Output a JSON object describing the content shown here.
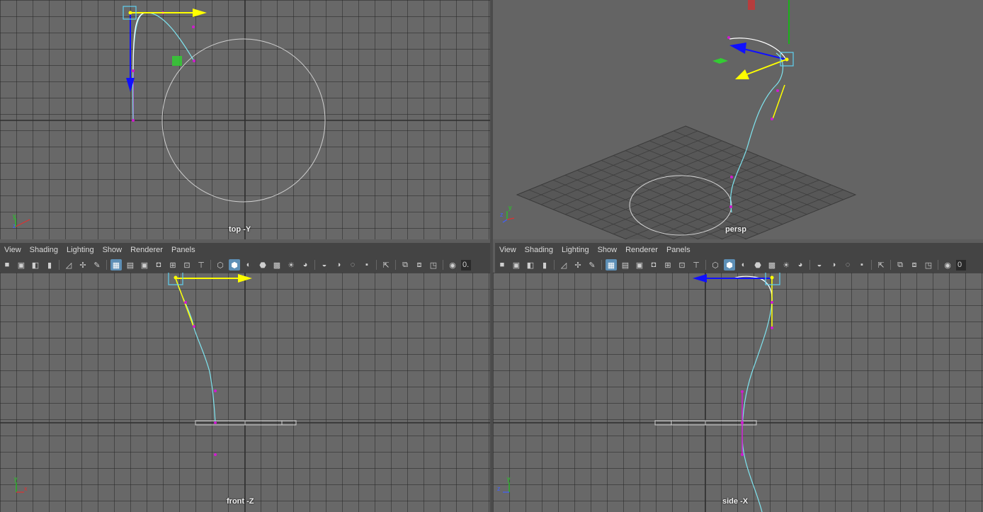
{
  "viewports": {
    "top": {
      "label": "top -Y"
    },
    "persp": {
      "label": "persp"
    },
    "front": {
      "label": "front -Z"
    },
    "side": {
      "label": "side -X"
    }
  },
  "panel_menu": [
    "View",
    "Shading",
    "Lighting",
    "Show",
    "Renderer",
    "Panels"
  ],
  "toolbar": {
    "field_value_left": "0.",
    "field_value_right": "0"
  },
  "axis_labels": {
    "x": "x",
    "y": "y",
    "z": "z"
  },
  "colors": {
    "viewport_bg": "#686868",
    "grid_line": "#3c3c3c",
    "curve": "#7fe5f0",
    "selected_curve": "#ffffff",
    "cv_point": "#d01ad0",
    "move_x": "#ffff00",
    "move_y": "#00cc00",
    "move_z": "#0000ff",
    "handle_box": "#5fd0f0"
  }
}
